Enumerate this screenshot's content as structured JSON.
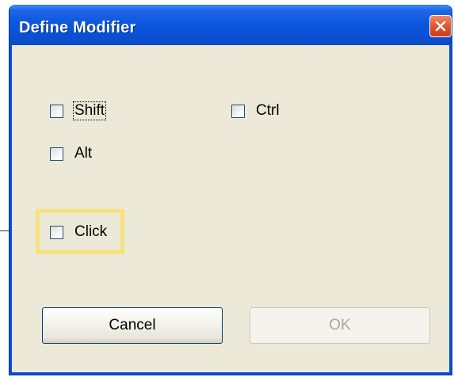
{
  "dialog": {
    "title": "Define Modifier"
  },
  "checkboxes": {
    "shift": {
      "label": "Shift",
      "checked": false
    },
    "ctrl": {
      "label": "Ctrl",
      "checked": false
    },
    "alt": {
      "label": "Alt",
      "checked": false
    },
    "click": {
      "label": "Click",
      "checked": false
    }
  },
  "buttons": {
    "cancel_label": "Cancel",
    "ok_label": "OK"
  },
  "colors": {
    "titlebar": "#0a4fd6",
    "client_background": "#ece9d8",
    "highlight_frame": "#f7e27d",
    "close_button": "#e2542d"
  }
}
